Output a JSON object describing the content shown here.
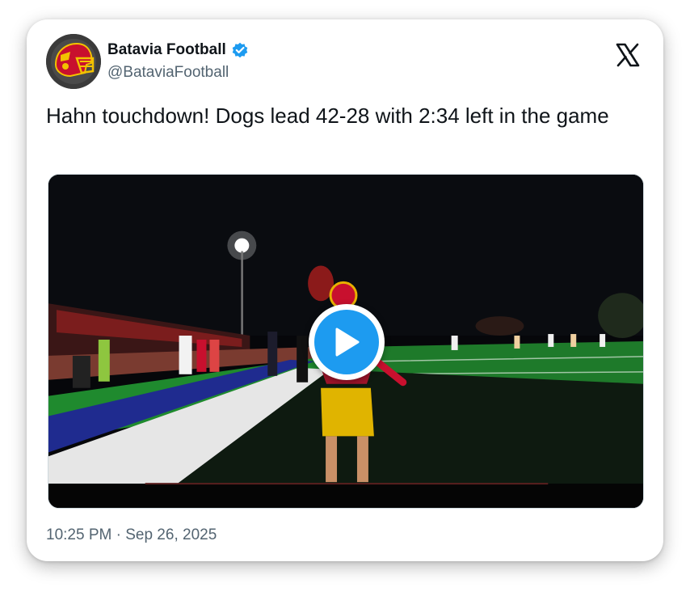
{
  "author": {
    "display_name": "Batavia Football",
    "handle": "@BataviaFootball",
    "verified": true,
    "avatar_icon": "helmet-logo-avatar"
  },
  "tweet": {
    "text": "Hahn touchdown! Dogs lead 42-28 with 2:34 left in the game"
  },
  "media": {
    "type": "video",
    "play_icon": "play-icon"
  },
  "meta": {
    "time": "10:25 PM",
    "separator": "·",
    "date": "Sep 26, 2025"
  },
  "colors": {
    "verified_blue": "#1d9bf0",
    "text_primary": "#0f1419",
    "text_secondary": "#536471"
  }
}
